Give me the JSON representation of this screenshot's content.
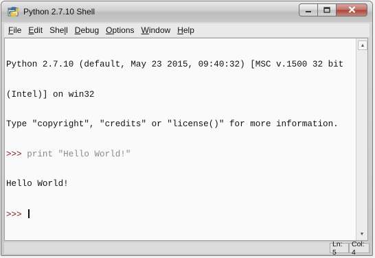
{
  "window": {
    "title": "Python 2.7.10 Shell"
  },
  "menu": {
    "items": [
      {
        "mnemonic": "F",
        "rest": "ile"
      },
      {
        "mnemonic": "E",
        "rest": "dit"
      },
      {
        "pre": "She",
        "mnemonic": "l",
        "rest": "l"
      },
      {
        "mnemonic": "D",
        "rest": "ebug"
      },
      {
        "mnemonic": "O",
        "rest": "ptions"
      },
      {
        "mnemonic": "W",
        "rest": "indow"
      },
      {
        "mnemonic": "H",
        "rest": "elp"
      }
    ]
  },
  "shell": {
    "banner_line1": "Python 2.7.10 (default, May 23 2015, 09:40:32) [MSC v.1500 32 bit",
    "banner_line2": "(Intel)] on win32",
    "banner_line3": "Type \"copyright\", \"credits\" or \"license()\" for more information.",
    "prompt": ">>> ",
    "command": "print \"Hello World!\"",
    "output": "Hello World!",
    "prompt_current": ">>> "
  },
  "status": {
    "line": "Ln: 5",
    "col": "Col: 4"
  },
  "icons": {
    "app": "python-idle-icon",
    "minimize": "minimize-icon",
    "maximize": "maximize-icon",
    "close": "close-icon",
    "scroll_up": "scroll-up-arrow-icon",
    "scroll_down": "scroll-down-arrow-icon"
  }
}
